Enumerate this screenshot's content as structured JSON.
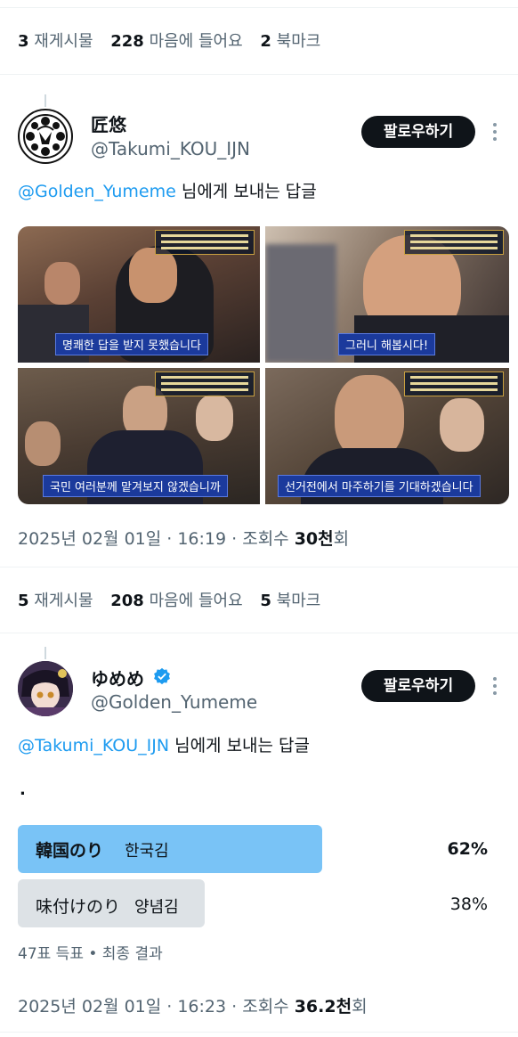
{
  "tweet1": {
    "stats": {
      "reposts_count": "3",
      "reposts_label": "재게시물",
      "likes_count": "228",
      "likes_label": "마음에 들어요",
      "bookmarks_count": "2",
      "bookmarks_label": "북마크"
    }
  },
  "reply1": {
    "name": "匠悠",
    "handle": "@Takumi_KOU_IJN",
    "follow_label": "팔로우하기",
    "reply_to_mention": "@Golden_Yumeme",
    "reply_to_suffix": " 님에게 보내는 답글",
    "captions": [
      "명쾌한 답을 받지 못했습니다",
      "그러니 해봅시다!",
      "국민 여러분께 맡겨보지 않겠습니까",
      "선거전에서 마주하기를 기대하겠습니다"
    ],
    "meta_prefix": "2025년 02월 01일 · 16:19 · 조회수 ",
    "meta_views": "30천",
    "meta_suffix": "회",
    "stats": {
      "reposts_count": "5",
      "reposts_label": "재게시물",
      "likes_count": "208",
      "likes_label": "마음에 들어요",
      "bookmarks_count": "5",
      "bookmarks_label": "북마크"
    }
  },
  "reply2": {
    "name": "ゆめめ",
    "handle": "@Golden_Yumeme",
    "follow_label": "팔로우하기",
    "reply_to_mention": "@Takumi_KOU_IJN",
    "reply_to_suffix": " 님에게 보내는 답글",
    "body_text": ".",
    "poll": {
      "options": [
        {
          "label": "韓国のり",
          "sub": "한국김",
          "percent": "62%",
          "fraction": 0.62,
          "winner": true
        },
        {
          "label": "味付けのり",
          "sub": "양념김",
          "percent": "38%",
          "fraction": 0.38,
          "winner": false
        }
      ],
      "footer": "47표 득표 • 최종 결과"
    },
    "meta_prefix": "2025년 02월 01일 · 16:23 · 조회수 ",
    "meta_views": "36.2천",
    "meta_suffix": "회"
  },
  "colors": {
    "accent": "#1d9bf0",
    "poll_winner": "#79c3f6",
    "poll_other": "#dde2e6",
    "caption_bg": "#1b3a9c"
  }
}
